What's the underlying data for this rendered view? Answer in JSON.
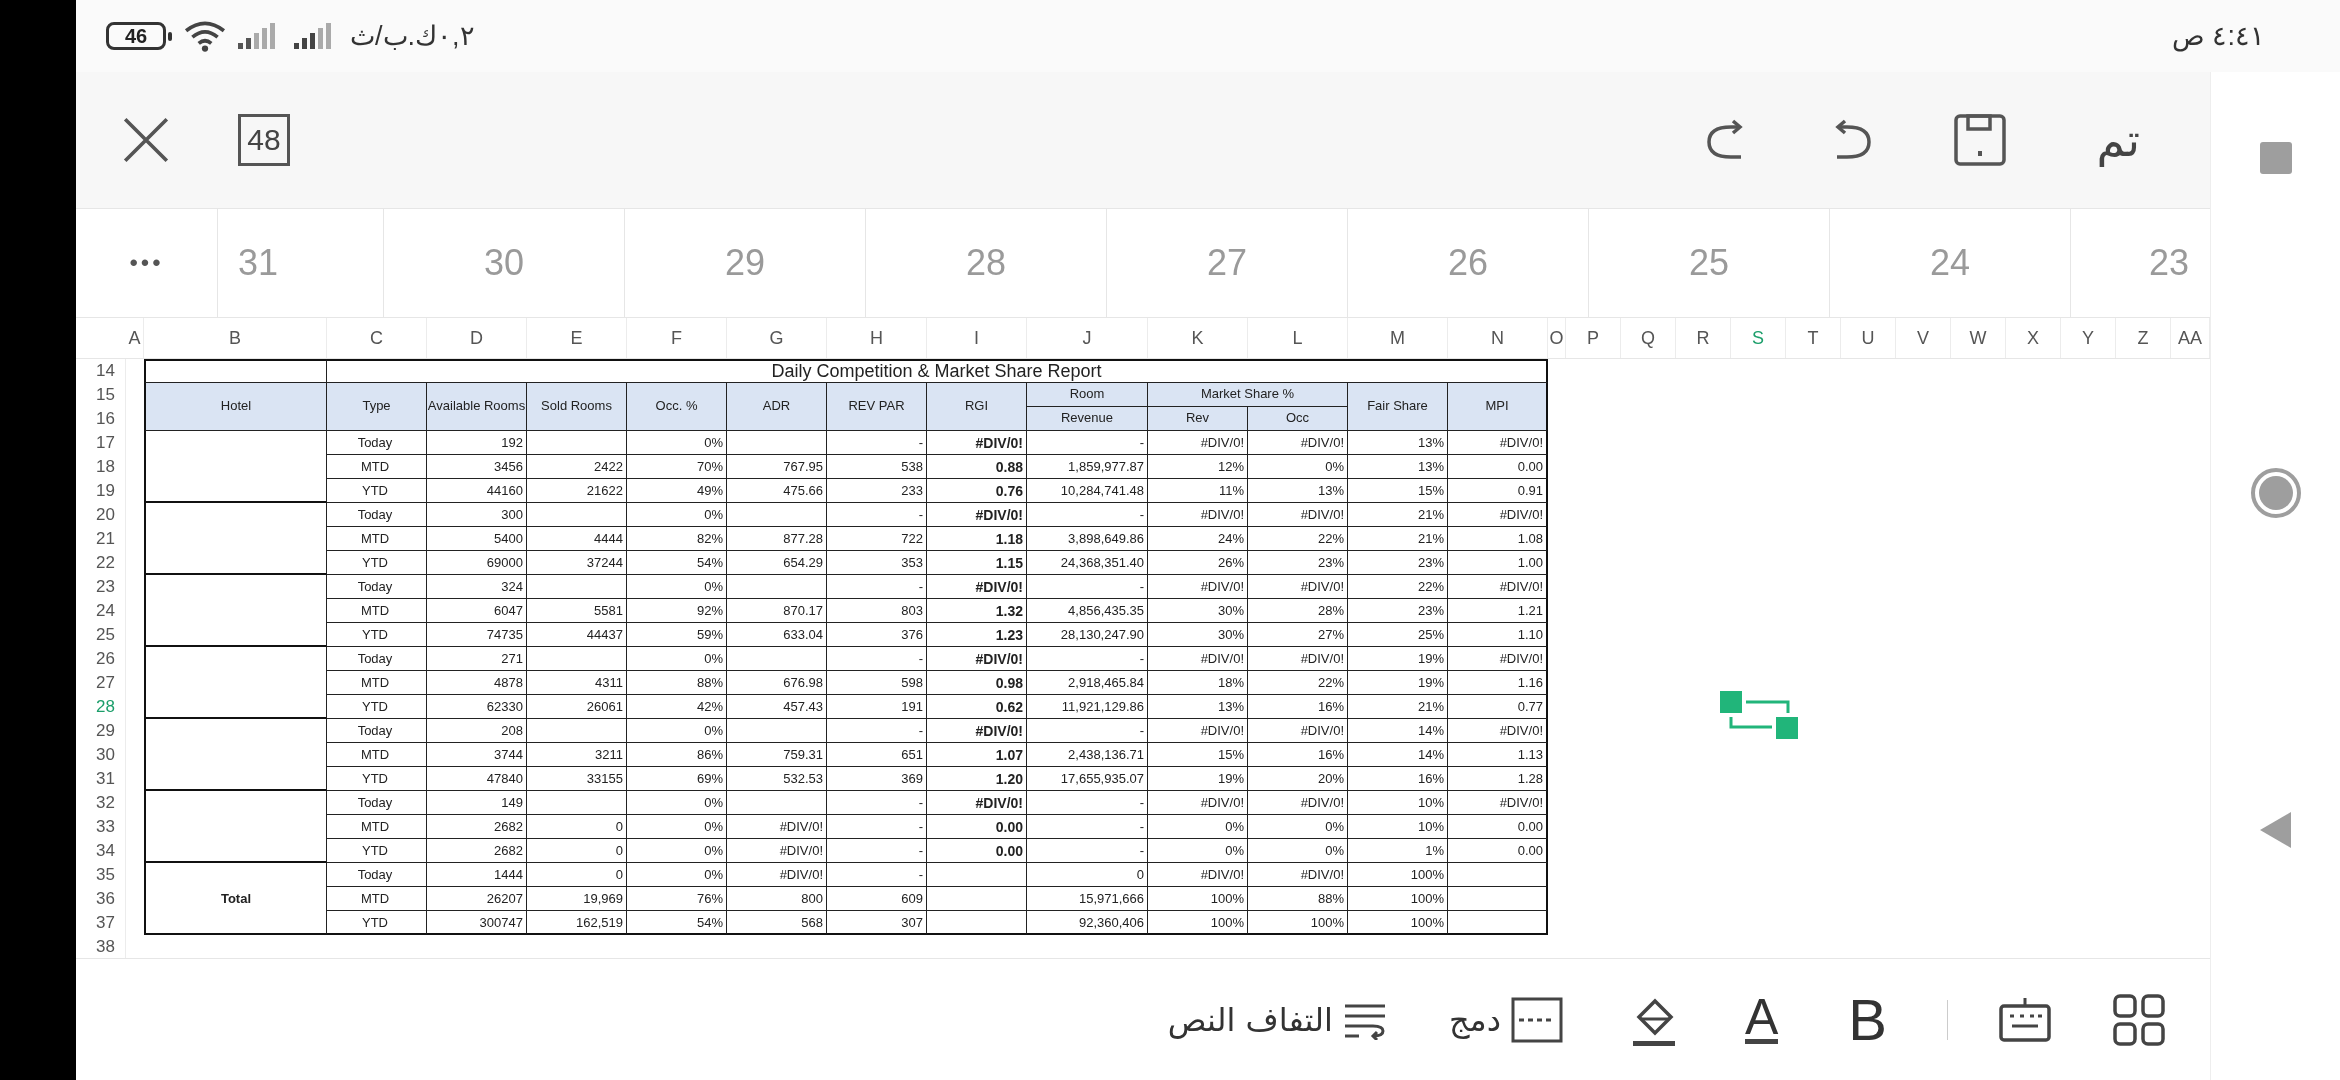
{
  "status_bar": {
    "battery": "46",
    "network_speed": "٠,٢ك.ب/ث",
    "time": "٤:٤١ ص"
  },
  "toolbar": {
    "page_count": "48",
    "done": "تم"
  },
  "page_strip": {
    "more": "•••",
    "pages": [
      "31",
      "30",
      "29",
      "28",
      "27",
      "26",
      "25",
      "24",
      "23"
    ]
  },
  "columns": [
    {
      "label": "A",
      "selected": false
    },
    {
      "label": "B",
      "selected": false
    },
    {
      "label": "C",
      "selected": false
    },
    {
      "label": "D",
      "selected": false
    },
    {
      "label": "E",
      "selected": false
    },
    {
      "label": "F",
      "selected": false
    },
    {
      "label": "G",
      "selected": false
    },
    {
      "label": "H",
      "selected": false
    },
    {
      "label": "I",
      "selected": false
    },
    {
      "label": "J",
      "selected": false
    },
    {
      "label": "K",
      "selected": false
    },
    {
      "label": "L",
      "selected": false
    },
    {
      "label": "M",
      "selected": false
    },
    {
      "label": "N",
      "selected": false
    },
    {
      "label": "O",
      "selected": false
    },
    {
      "label": "P",
      "selected": false
    },
    {
      "label": "Q",
      "selected": false
    },
    {
      "label": "R",
      "selected": false
    },
    {
      "label": "S",
      "selected": true
    },
    {
      "label": "T",
      "selected": false
    },
    {
      "label": "U",
      "selected": false
    },
    {
      "label": "V",
      "selected": false
    },
    {
      "label": "W",
      "selected": false
    },
    {
      "label": "X",
      "selected": false
    },
    {
      "label": "Y",
      "selected": false
    },
    {
      "label": "Z",
      "selected": false
    },
    {
      "label": "AA",
      "selected": false
    }
  ],
  "row_numbers": [
    {
      "label": "14",
      "selected": false
    },
    {
      "label": "15",
      "selected": false
    },
    {
      "label": "16",
      "selected": false
    },
    {
      "label": "17",
      "selected": false
    },
    {
      "label": "18",
      "selected": false
    },
    {
      "label": "19",
      "selected": false
    },
    {
      "label": "20",
      "selected": false
    },
    {
      "label": "21",
      "selected": false
    },
    {
      "label": "22",
      "selected": false
    },
    {
      "label": "23",
      "selected": false
    },
    {
      "label": "24",
      "selected": false
    },
    {
      "label": "25",
      "selected": false
    },
    {
      "label": "26",
      "selected": false
    },
    {
      "label": "27",
      "selected": false
    },
    {
      "label": "28",
      "selected": true
    },
    {
      "label": "29",
      "selected": false
    },
    {
      "label": "30",
      "selected": false
    },
    {
      "label": "31",
      "selected": false
    },
    {
      "label": "32",
      "selected": false
    },
    {
      "label": "33",
      "selected": false
    },
    {
      "label": "34",
      "selected": false
    },
    {
      "label": "35",
      "selected": false
    },
    {
      "label": "36",
      "selected": false
    },
    {
      "label": "37",
      "selected": false
    },
    {
      "label": "38",
      "selected": false
    }
  ],
  "report": {
    "title": "Daily Competition & Market Share Report",
    "headers": {
      "hotel": "Hotel",
      "type": "Type",
      "available_rooms": "Available Rooms",
      "sold_rooms": "Sold Rooms",
      "occupancy": "Occ. %",
      "adr": "ADR",
      "rev_par": "REV PAR",
      "rgi": "RGI",
      "room": "Room",
      "revenue": "Revenue",
      "market_share": "Market Share %",
      "share_rev": "Rev",
      "share_occ": "Occ",
      "fair_share": "Fair Share",
      "mpi": "MPI"
    },
    "groups": [
      {
        "rows": [
          {
            "type": "Today",
            "available_rooms": "192",
            "occupancy": "0%",
            "rev_par": "-",
            "rgi": "#DIV/0!",
            "revenue": "-",
            "share_rev": "#DIV/0!",
            "share_occ": "#DIV/0!",
            "fair_share": "13%",
            "mpi": "#DIV/0!"
          },
          {
            "type": "MTD",
            "available_rooms": "3456",
            "sold_rooms": "2422",
            "occupancy": "70%",
            "adr": "767.95",
            "rev_par": "538",
            "rgi": "0.88",
            "revenue": "1,859,977.87",
            "share_rev": "12%",
            "share_occ": "0%",
            "fair_share": "13%",
            "mpi": "0.00"
          },
          {
            "type": "YTD",
            "available_rooms": "44160",
            "sold_rooms": "21622",
            "occupancy": "49%",
            "adr": "475.66",
            "rev_par": "233",
            "rgi": "0.76",
            "revenue": "10,284,741.48",
            "share_rev": "11%",
            "share_occ": "13%",
            "fair_share": "15%",
            "mpi": "0.91"
          }
        ]
      },
      {
        "rows": [
          {
            "type": "Today",
            "available_rooms": "300",
            "occupancy": "0%",
            "rev_par": "-",
            "rgi": "#DIV/0!",
            "revenue": "-",
            "share_rev": "#DIV/0!",
            "share_occ": "#DIV/0!",
            "fair_share": "21%",
            "mpi": "#DIV/0!"
          },
          {
            "type": "MTD",
            "available_rooms": "5400",
            "sold_rooms": "4444",
            "occupancy": "82%",
            "adr": "877.28",
            "rev_par": "722",
            "rgi": "1.18",
            "revenue": "3,898,649.86",
            "share_rev": "24%",
            "share_occ": "22%",
            "fair_share": "21%",
            "mpi": "1.08"
          },
          {
            "type": "YTD",
            "available_rooms": "69000",
            "sold_rooms": "37244",
            "occupancy": "54%",
            "adr": "654.29",
            "rev_par": "353",
            "rgi": "1.15",
            "revenue": "24,368,351.40",
            "share_rev": "26%",
            "share_occ": "23%",
            "fair_share": "23%",
            "mpi": "1.00"
          }
        ]
      },
      {
        "rows": [
          {
            "type": "Today",
            "available_rooms": "324",
            "occupancy": "0%",
            "rev_par": "-",
            "rgi": "#DIV/0!",
            "revenue": "-",
            "share_rev": "#DIV/0!",
            "share_occ": "#DIV/0!",
            "fair_share": "22%",
            "mpi": "#DIV/0!"
          },
          {
            "type": "MTD",
            "available_rooms": "6047",
            "sold_rooms": "5581",
            "occupancy": "92%",
            "adr": "870.17",
            "rev_par": "803",
            "rgi": "1.32",
            "revenue": "4,856,435.35",
            "share_rev": "30%",
            "share_occ": "28%",
            "fair_share": "23%",
            "mpi": "1.21"
          },
          {
            "type": "YTD",
            "available_rooms": "74735",
            "sold_rooms": "44437",
            "occupancy": "59%",
            "adr": "633.04",
            "rev_par": "376",
            "rgi": "1.23",
            "revenue": "28,130,247.90",
            "share_rev": "30%",
            "share_occ": "27%",
            "fair_share": "25%",
            "mpi": "1.10"
          }
        ]
      },
      {
        "rows": [
          {
            "type": "Today",
            "available_rooms": "271",
            "occupancy": "0%",
            "rev_par": "-",
            "rgi": "#DIV/0!",
            "revenue": "-",
            "share_rev": "#DIV/0!",
            "share_occ": "#DIV/0!",
            "fair_share": "19%",
            "mpi": "#DIV/0!"
          },
          {
            "type": "MTD",
            "available_rooms": "4878",
            "sold_rooms": "4311",
            "occupancy": "88%",
            "adr": "676.98",
            "rev_par": "598",
            "rgi": "0.98",
            "revenue": "2,918,465.84",
            "share_rev": "18%",
            "share_occ": "22%",
            "fair_share": "19%",
            "mpi": "1.16"
          },
          {
            "type": "YTD",
            "available_rooms": "62330",
            "sold_rooms": "26061",
            "occupancy": "42%",
            "adr": "457.43",
            "rev_par": "191",
            "rgi": "0.62",
            "revenue": "11,921,129.86",
            "share_rev": "13%",
            "share_occ": "16%",
            "fair_share": "21%",
            "mpi": "0.77"
          }
        ]
      },
      {
        "rows": [
          {
            "type": "Today",
            "available_rooms": "208",
            "occupancy": "0%",
            "rev_par": "-",
            "rgi": "#DIV/0!",
            "revenue": "-",
            "share_rev": "#DIV/0!",
            "share_occ": "#DIV/0!",
            "fair_share": "14%",
            "mpi": "#DIV/0!"
          },
          {
            "type": "MTD",
            "available_rooms": "3744",
            "sold_rooms": "3211",
            "occupancy": "86%",
            "adr": "759.31",
            "rev_par": "651",
            "rgi": "1.07",
            "revenue": "2,438,136.71",
            "share_rev": "15%",
            "share_occ": "16%",
            "fair_share": "14%",
            "mpi": "1.13"
          },
          {
            "type": "YTD",
            "available_rooms": "47840",
            "sold_rooms": "33155",
            "occupancy": "69%",
            "adr": "532.53",
            "rev_par": "369",
            "rgi": "1.20",
            "revenue": "17,655,935.07",
            "share_rev": "19%",
            "share_occ": "20%",
            "fair_share": "16%",
            "mpi": "1.28"
          }
        ]
      },
      {
        "rows": [
          {
            "type": "Today",
            "available_rooms": "149",
            "occupancy": "0%",
            "rev_par": "-",
            "rgi": "#DIV/0!",
            "revenue": "-",
            "share_rev": "#DIV/0!",
            "share_occ": "#DIV/0!",
            "fair_share": "10%",
            "mpi": "#DIV/0!"
          },
          {
            "type": "MTD",
            "available_rooms": "2682",
            "sold_rooms": "0",
            "occupancy": "0%",
            "adr": "#DIV/0!",
            "rev_par": "-",
            "rgi": "0.00",
            "revenue": "-",
            "share_rev": "0%",
            "share_occ": "0%",
            "fair_share": "10%",
            "mpi": "0.00"
          },
          {
            "type": "YTD",
            "available_rooms": "2682",
            "sold_rooms": "0",
            "occupancy": "0%",
            "adr": "#DIV/0!",
            "rev_par": "-",
            "rgi": "0.00",
            "revenue": "-",
            "share_rev": "0%",
            "share_occ": "0%",
            "fair_share": "1%",
            "mpi": "0.00"
          }
        ]
      },
      {
        "hotel": "Total",
        "rows": [
          {
            "type": "Today",
            "available_rooms": "1444",
            "sold_rooms": "0",
            "occupancy": "0%",
            "adr": "#DIV/0!",
            "rev_par": "-",
            "revenue": "0",
            "share_rev": "#DIV/0!",
            "share_occ": "#DIV/0!",
            "fair_share": "100%"
          },
          {
            "type": "MTD",
            "available_rooms": "26207",
            "sold_rooms": "19,969",
            "occupancy": "76%",
            "adr": "800",
            "rev_par": "609",
            "revenue": "15,971,666",
            "share_rev": "100%",
            "share_occ": "88%",
            "fair_share": "100%"
          },
          {
            "type": "YTD",
            "available_rooms": "300747",
            "sold_rooms": "162,519",
            "occupancy": "54%",
            "adr": "568",
            "rev_par": "307",
            "revenue": "92,360,406",
            "share_rev": "100%",
            "share_occ": "100%",
            "fair_share": "100%"
          }
        ]
      }
    ]
  },
  "bottom_toolbar": {
    "wrap_text": "التفاف النص",
    "merge": "دمج",
    "font_color": "A",
    "bold": "B"
  }
}
